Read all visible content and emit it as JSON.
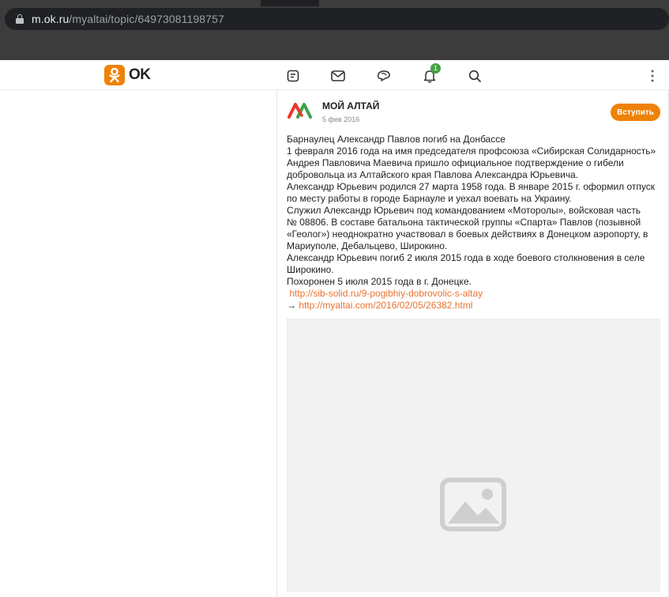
{
  "browser": {
    "url_host": "m.ok.ru",
    "url_path": "/myaltai/topic/64973081198757"
  },
  "header": {
    "logo_text": "OK",
    "notification_count": "1",
    "icons": [
      "feed-icon",
      "messages-icon",
      "discussions-icon",
      "notifications-icon",
      "search-icon",
      "more-icon"
    ]
  },
  "post": {
    "group_name": "МОЙ АЛТАЙ",
    "date": "5 фев 2016",
    "join_label": "Вступить",
    "lines": [
      "Барнаулец Александр Павлов погиб на Донбассе",
      "1 февраля 2016 года на имя председателя профсоюза «Сибирская Солидарность»",
      "Андрея Павловича Маевича пришло официальное подтверждение о гибели",
      "добровольца из Алтайского края Павлова Александра Юрьевича.",
      "Александр Юрьевич родился 27 марта 1958 года. В январе 2015 г. оформил отпуск",
      "по месту работы в городе Барнауле и уехал воевать на Украину.",
      "Служил Александр Юрьевич под командованием «Моторолы», войсковая часть",
      "№ 08806. В составе батальона тактической группы «Спарта» Павлов (позывной",
      "«Геолог») неоднократно участвовал в боевых действиях в Донецком аэропорту, в",
      "Мариуполе, Дебальцево, Широкино.",
      "Александр Юрьевич погиб 2 июля 2015 года в ходе боевого столкновения в селе",
      "Широкино.",
      "Похоронен 5 июля 2015 года в г. Донецке."
    ],
    "link1": "http://sib-solid.ru/9-pogibhiy-dobrovolic-s-altay",
    "link2_prefix": "→ ",
    "link2": "http://myaltai.com/2016/02/05/26382.html"
  },
  "colors": {
    "accent": "#ee8208",
    "link": "#eb722e",
    "badge": "#45a045"
  }
}
